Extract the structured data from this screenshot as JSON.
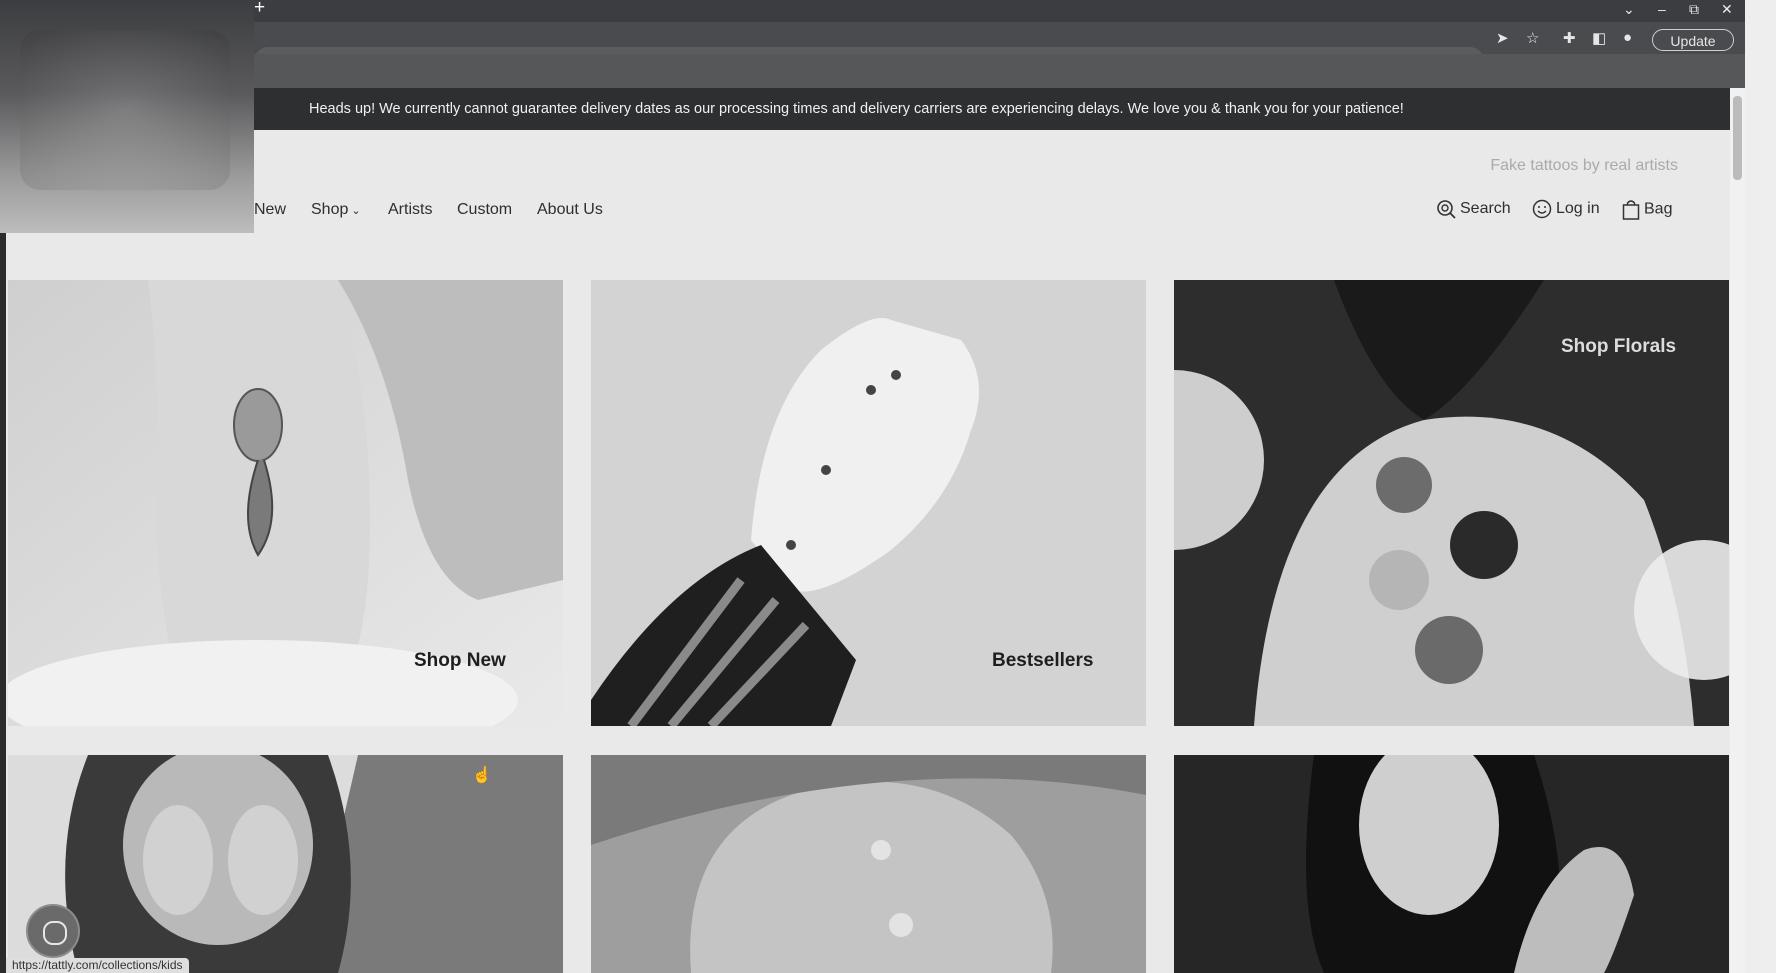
{
  "browser": {
    "new_tab_glyph": "+",
    "window_controls": [
      "⌄",
      "–",
      "⧉",
      "✕"
    ],
    "toolbar_icons": [
      "send-icon",
      "star-icon",
      "extensions-icon",
      "sidepanel-icon",
      "profile-icon"
    ],
    "update_label": "Update",
    "status_url": "https://tattly.com/collections/kids"
  },
  "announcement": {
    "text": "Heads up! We currently cannot guarantee delivery dates as our processing times and delivery carriers are experiencing delays. We love you & thank you for your patience!"
  },
  "header": {
    "tagline": "Fake tattoos by real artists",
    "nav": {
      "new": "New",
      "shop": "Shop",
      "artists": "Artists",
      "custom": "Custom",
      "about": "About Us"
    },
    "utility": {
      "search": "Search",
      "login": "Log in",
      "bag": "Bag"
    }
  },
  "tiles": {
    "shop_new": "Shop New",
    "bestsellers": "Bestsellers",
    "shop_florals": "Shop Florals"
  },
  "colors": {
    "announcement_bg": "#2e2f31",
    "page_bg": "#e9e9ea",
    "text_dark": "#2e2e2e"
  }
}
